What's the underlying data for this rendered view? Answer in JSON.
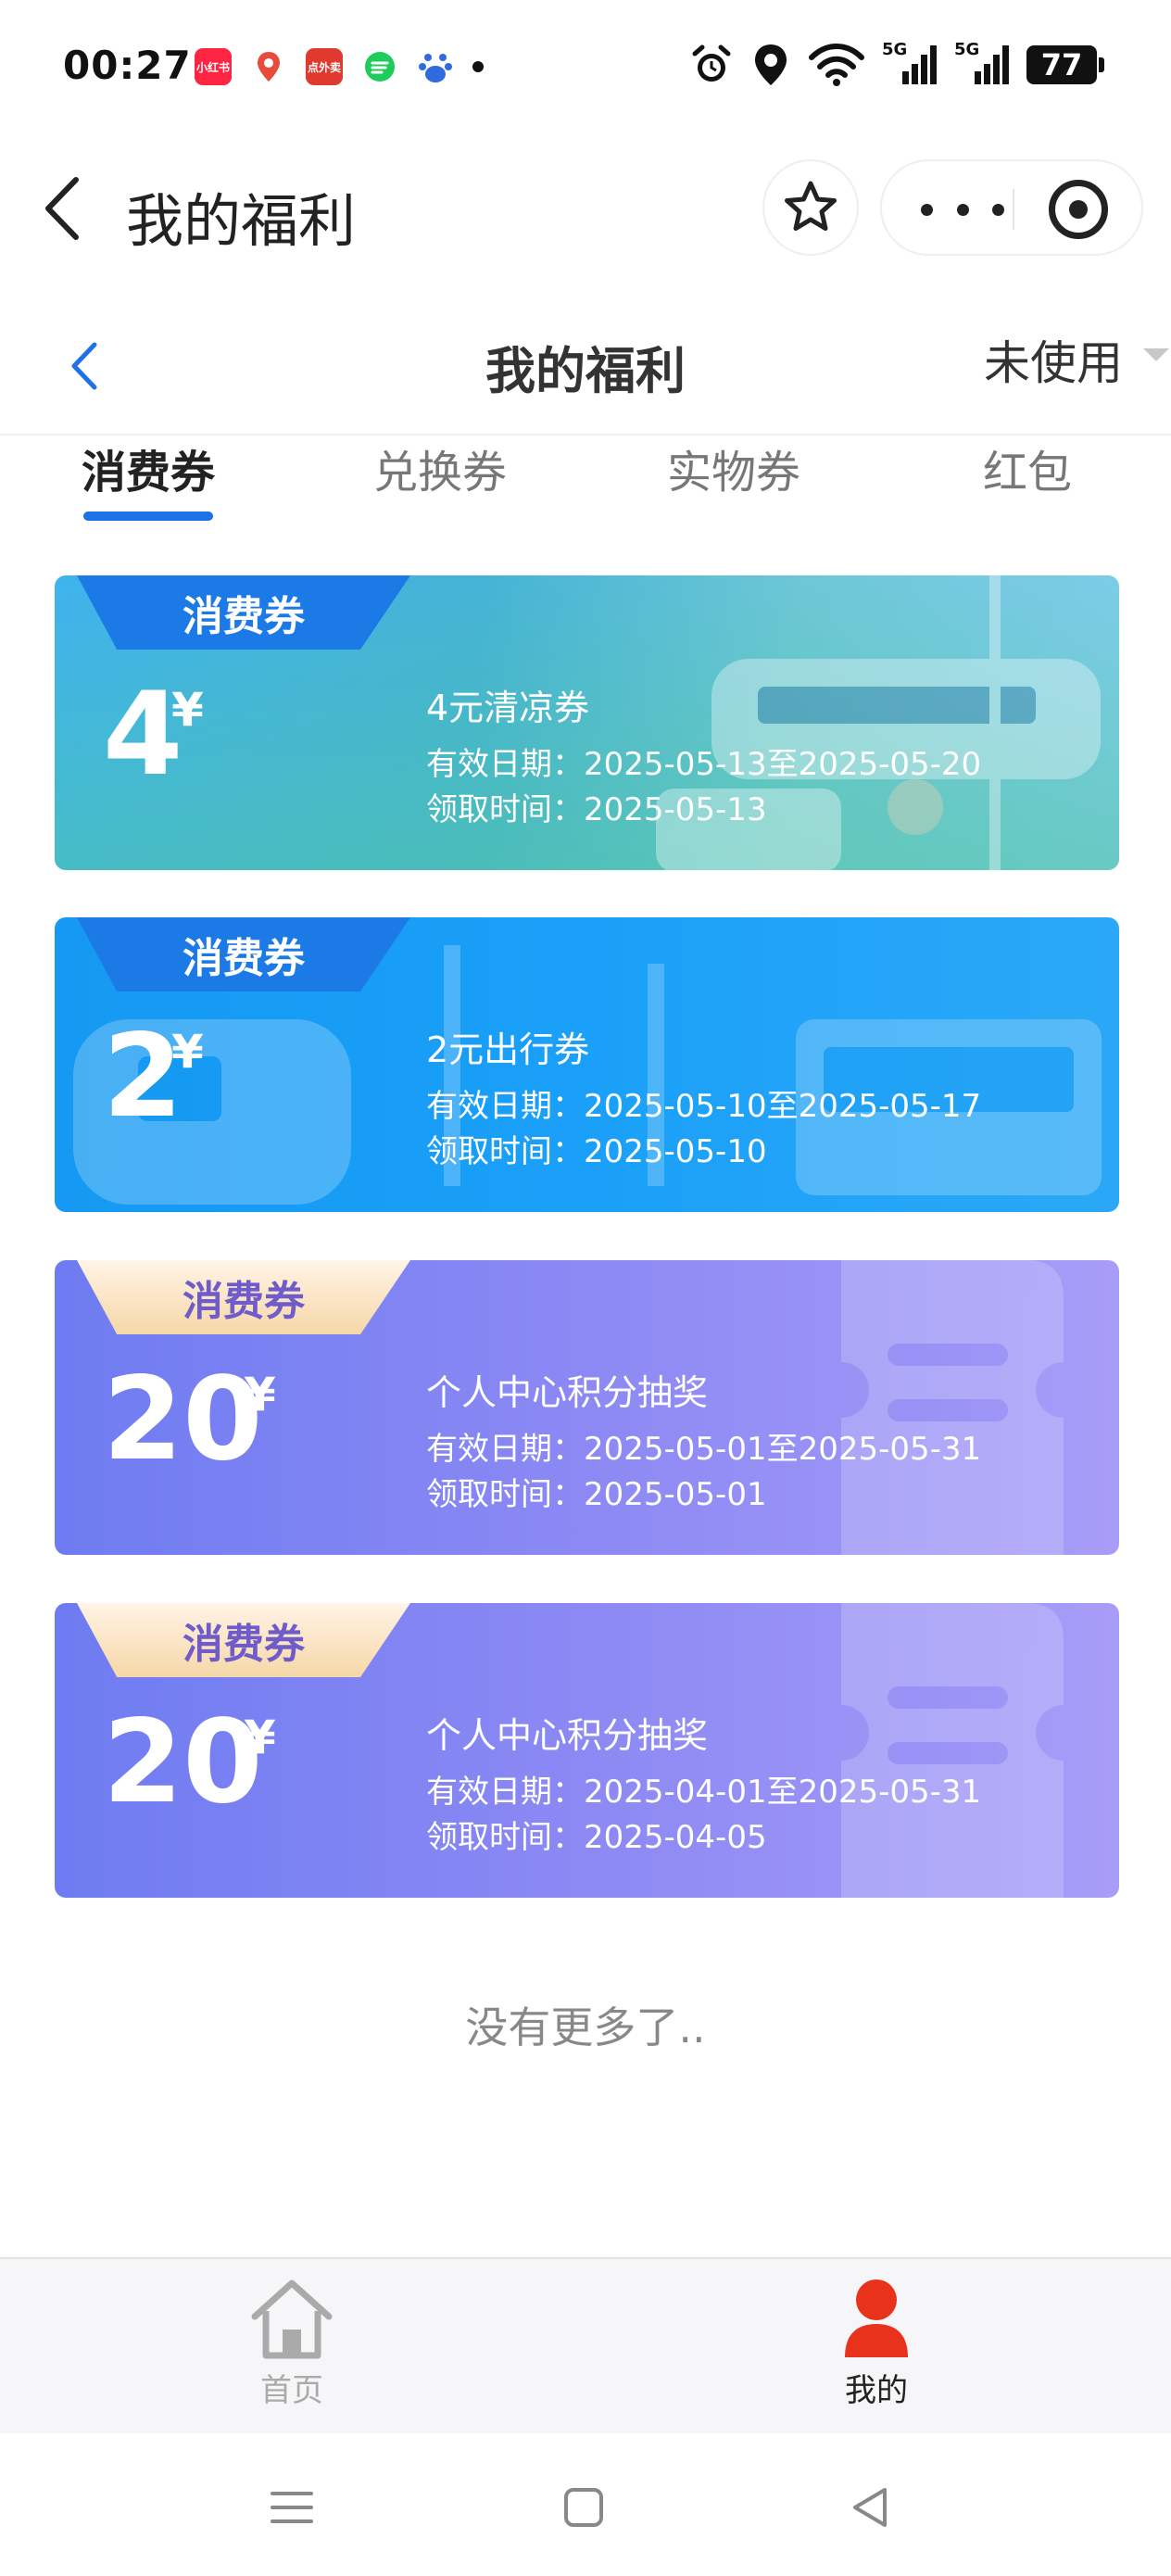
{
  "status_bar": {
    "time": "00:27",
    "apps": [
      {
        "icon": "xiaohongshu-icon",
        "label": "小红书",
        "color": "#ff2442"
      },
      {
        "icon": "baidu-map-icon",
        "label": "du",
        "color": "#ffffff"
      },
      {
        "icon": "eleme-icon",
        "label": "点外卖",
        "color": "#e03a2f"
      },
      {
        "icon": "chat-app-icon",
        "label": "",
        "color": "#1fcc5b"
      },
      {
        "icon": "baidu-icon",
        "label": "du",
        "color": "#2f6bdd"
      }
    ],
    "network": "5G",
    "battery": "77"
  },
  "app_header": {
    "title": "我的福利"
  },
  "page_nav": {
    "title": "我的福利",
    "filter": "未使用"
  },
  "tabs": [
    {
      "label": "消费券",
      "active": true
    },
    {
      "label": "兑换券",
      "active": false
    },
    {
      "label": "实物券",
      "active": false
    },
    {
      "label": "红包",
      "active": false
    }
  ],
  "coupons": [
    {
      "badge": "消费券",
      "amount": "4",
      "currency": "¥",
      "name": "4元清凉券",
      "valid": "有效日期：2025-05-13至2025-05-20",
      "received": "领取时间：2025-05-13"
    },
    {
      "badge": "消费券",
      "amount": "2",
      "currency": "¥",
      "name": "2元出行券",
      "valid": "有效日期：2025-05-10至2025-05-17",
      "received": "领取时间：2025-05-10"
    },
    {
      "badge": "消费券",
      "amount": "20",
      "currency": "¥",
      "name": "个人中心积分抽奖",
      "valid": "有效日期：2025-05-01至2025-05-31",
      "received": "领取时间：2025-05-01"
    },
    {
      "badge": "消费券",
      "amount": "20",
      "currency": "¥",
      "name": "个人中心积分抽奖",
      "valid": "有效日期：2025-04-01至2025-05-31",
      "received": "领取时间：2025-04-05"
    }
  ],
  "no_more": "没有更多了..",
  "tabbar": {
    "home": "首页",
    "mine": "我的"
  },
  "colors": {
    "accent": "#1e72e8",
    "mine_active": "#e8321c"
  }
}
